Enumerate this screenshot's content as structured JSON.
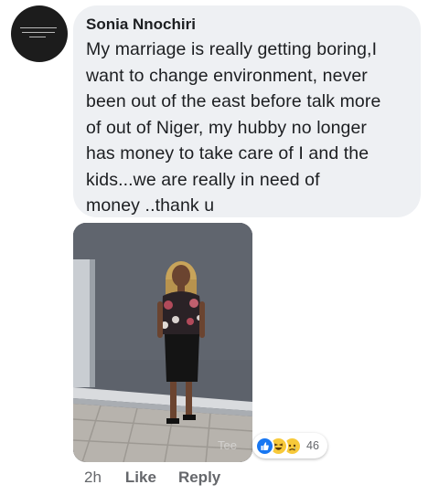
{
  "comment": {
    "author": "Sonia Nnochiri",
    "lines": [
      "My marriage is really getting boring,I",
      "want to change environment, never",
      "been out of the east before talk more",
      "of out of Niger, my hubby no longer",
      "has money to take care of I and the",
      "kids...we are really in need of",
      "money ..thank u"
    ]
  },
  "attachment": {
    "watermark": "Tee"
  },
  "reactions": {
    "icons": [
      "like-icon",
      "haha-icon",
      "sad-icon"
    ],
    "count": "46"
  },
  "actions": {
    "time": "2h",
    "like_label": "Like",
    "reply_label": "Reply"
  },
  "colors": {
    "bubble": "#eef0f3",
    "like_blue": "#1877f2",
    "secondary_text": "#65676b"
  }
}
